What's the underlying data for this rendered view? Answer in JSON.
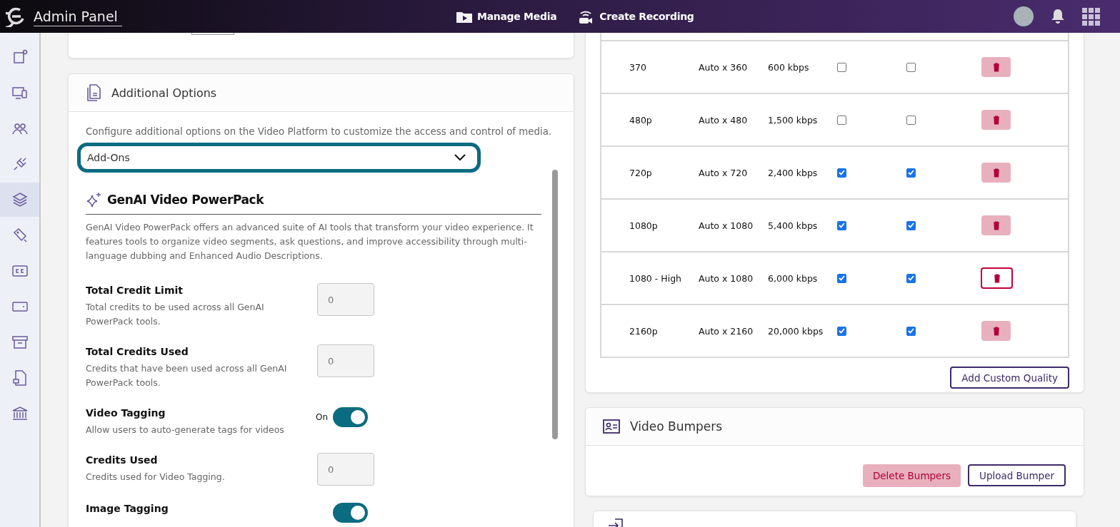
{
  "header": {
    "title": "Admin Panel",
    "nav": [
      {
        "label": "Manage Media"
      },
      {
        "label": "Create Recording"
      }
    ]
  },
  "sidebar": {
    "items": [
      {
        "selected": false
      },
      {
        "selected": false
      },
      {
        "selected": false
      },
      {
        "selected": false
      },
      {
        "selected": true
      },
      {
        "selected": false
      },
      {
        "selected": false
      },
      {
        "selected": false
      },
      {
        "selected": false
      },
      {
        "selected": false
      },
      {
        "selected": false
      }
    ]
  },
  "additional_options": {
    "title": "Additional Options",
    "description": "Configure additional options on the Video Platform to customize the access and control of media.",
    "dropdown": {
      "value": "Add-Ons"
    },
    "addon": {
      "title": "GenAI Video PowerPack",
      "description": "GenAI Video PowerPack offers an advanced suite of AI tools that transform your video experience. It features tools to organize video segments, ask questions, and improve accessibility through multi-language dubbing and Enhanced Audio Descriptions.",
      "settings": [
        {
          "kind": "number",
          "label": "Total Credit Limit",
          "description": "Total credits to be used across all GenAI PowerPack tools.",
          "placeholder": "0",
          "disabled": true
        },
        {
          "kind": "number",
          "label": "Total Credits Used",
          "description": "Credits that have been used across all GenAI PowerPack tools.",
          "placeholder": "0",
          "disabled": true
        },
        {
          "kind": "toggle",
          "label": "Video Tagging",
          "description": "Allow users to auto-generate tags for videos",
          "state_label": "On",
          "on": true
        },
        {
          "kind": "number",
          "label": "Credits Used",
          "description": "Credits used for Video Tagging.",
          "placeholder": "0",
          "disabled": true
        },
        {
          "kind": "toggle",
          "label": "Image Tagging",
          "on": true
        }
      ]
    }
  },
  "quality_table": {
    "rows": [
      {
        "quality": "370",
        "resolution": "Auto x 360",
        "bitrate": "600 kbps",
        "checkboxes": [
          {
            "checked": false
          },
          {
            "checked": false
          }
        ],
        "delete_focused": false
      },
      {
        "quality": "480p",
        "resolution": "Auto x 480",
        "bitrate": "1,500 kbps",
        "checkboxes": [
          {
            "checked": false
          },
          {
            "checked": false
          }
        ],
        "delete_focused": false
      },
      {
        "quality": "720p",
        "resolution": "Auto x 720",
        "bitrate": "2,400 kbps",
        "checkboxes": [
          {
            "checked": true
          },
          {
            "checked": true
          }
        ],
        "delete_focused": false
      },
      {
        "quality": "1080p",
        "resolution": "Auto x 1080",
        "bitrate": "5,400 kbps",
        "checkboxes": [
          {
            "checked": true
          },
          {
            "checked": true
          }
        ],
        "delete_focused": false
      },
      {
        "quality": "1080 - High",
        "resolution": "Auto x 1080",
        "bitrate": "6,000 kbps",
        "checkboxes": [
          {
            "checked": true
          },
          {
            "checked": true
          }
        ],
        "delete_focused": true
      },
      {
        "quality": "2160p",
        "resolution": "Auto x 2160",
        "bitrate": "20,000 kbps",
        "checkboxes": [
          {
            "checked": true
          },
          {
            "checked": true
          }
        ],
        "delete_focused": false
      }
    ],
    "add_button": "Add Custom Quality"
  },
  "video_bumpers": {
    "title": "Video Bumpers",
    "buttons": [
      {
        "kind": "danger",
        "label": "Delete Bumpers"
      },
      {
        "kind": "outline",
        "label": "Upload Bumper"
      }
    ]
  }
}
